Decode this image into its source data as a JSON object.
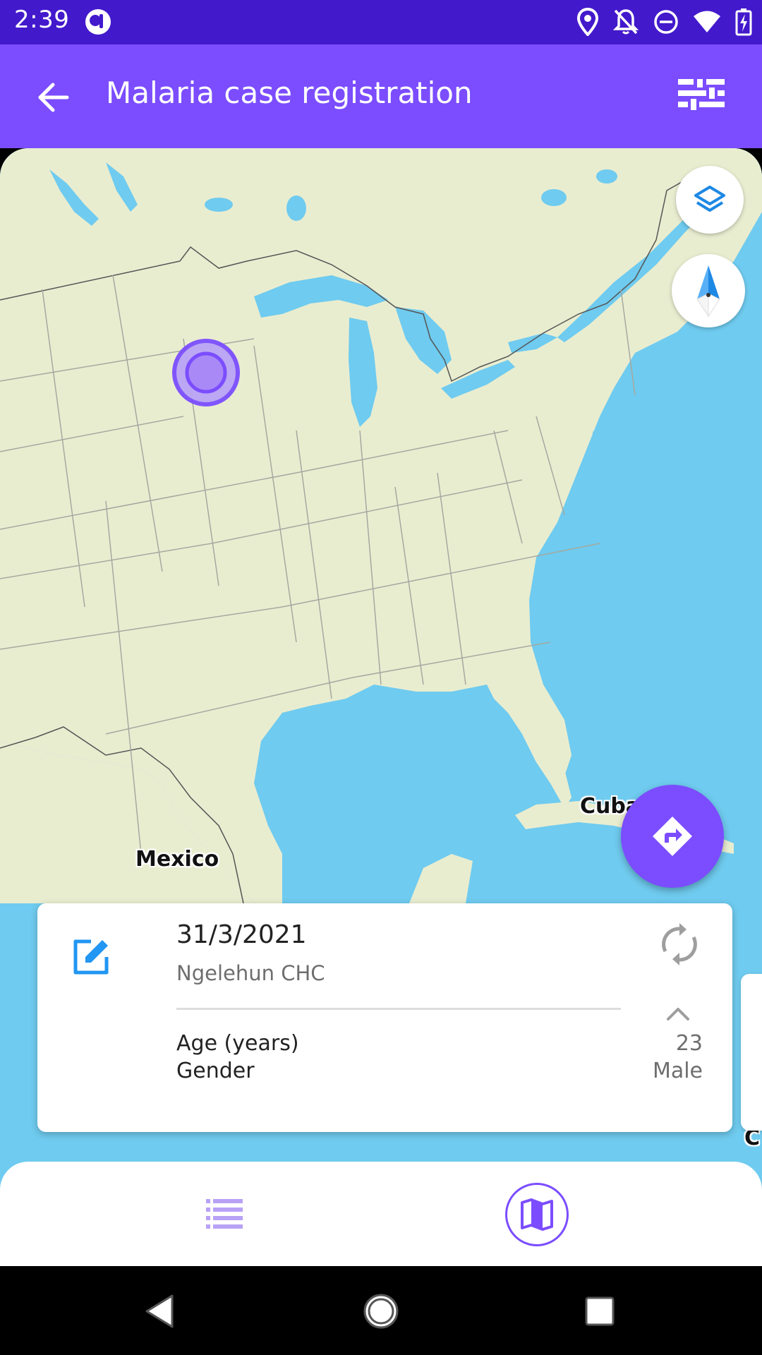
{
  "status_bar": {
    "time": "2:39",
    "icons": [
      "app-notification-icon",
      "location-icon",
      "notifications-off-icon",
      "do-not-disturb-icon",
      "wifi-icon",
      "battery-charging-icon"
    ]
  },
  "app_bar": {
    "title": "Malaria case registration",
    "back_icon": "arrow-back-icon",
    "filter_icon": "filter-icon"
  },
  "map": {
    "labels": {
      "country_1": "Mexico",
      "country_2": "Cuba",
      "partial_label": "C"
    },
    "controls": {
      "layers_icon": "layers-icon",
      "compass_icon": "compass-icon",
      "navigate_icon": "directions-icon"
    },
    "colors": {
      "water": "#6fcbef",
      "land": "#e9edd0",
      "marker": "#7b4dff"
    }
  },
  "event_card": {
    "date": "31/3/2021",
    "org_unit": "Ngelehun CHC",
    "attributes": [
      {
        "label": "Age (years)",
        "value": "23"
      },
      {
        "label": "Gender",
        "value": "Male"
      }
    ],
    "icons": [
      "edit-icon",
      "sync-icon",
      "chevron-up-icon"
    ]
  },
  "bottom_nav": {
    "items": [
      {
        "name": "list-view",
        "icon": "list-icon",
        "selected": false
      },
      {
        "name": "map-view",
        "icon": "map-icon",
        "selected": true
      }
    ]
  },
  "theme": {
    "primary": "#7b4dff",
    "status_bar": "#4319cc"
  }
}
